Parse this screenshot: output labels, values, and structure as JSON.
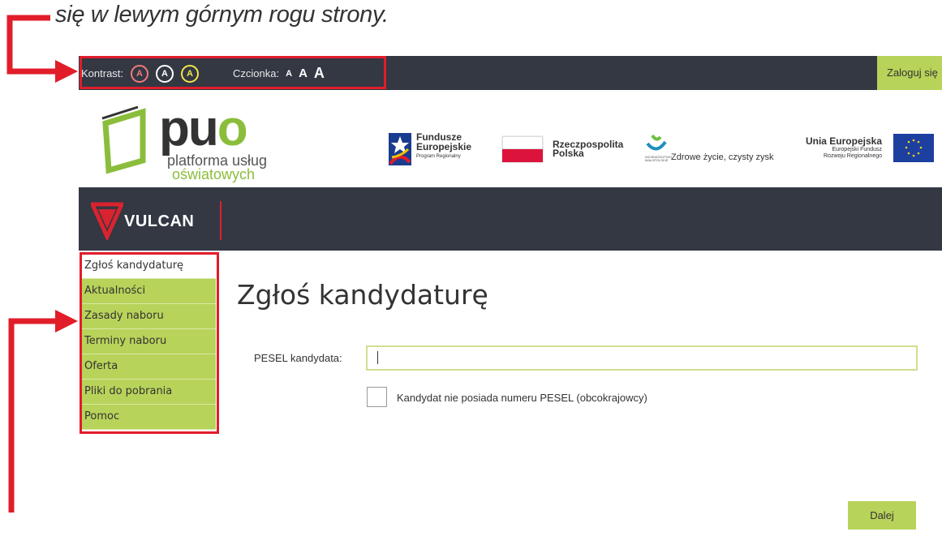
{
  "caption": "się w lewym górnym rogu strony.",
  "topbar": {
    "contrast_label": "Kontrast:",
    "contrast_options": [
      "A",
      "A",
      "A"
    ],
    "font_label": "Czcionka:",
    "font_sizes": [
      "A",
      "A",
      "A"
    ],
    "login_label": "Zaloguj się"
  },
  "logos": {
    "puo_main_a": "pu",
    "puo_main_b": "o",
    "puo_sub1": "platforma usług",
    "puo_sub2": "oświatowych",
    "fe_title1": "Fundusze",
    "fe_title2": "Europejskie",
    "fe_sub": "Program Regionalny",
    "rp_line1": "Rzeczpospolita",
    "rp_line2": "Polska",
    "mr_sub": "WOJEWÓDZTWO MAŁOPOLSKIE",
    "mr_slogan": "Zdrowe życie, czysty zysk",
    "ue_title": "Unia Europejska",
    "ue_sub1": "Europejski Fundusz",
    "ue_sub2": "Rozwoju Regionalnego",
    "vulcan": "VULCAN"
  },
  "sidebar": {
    "items": [
      {
        "label": "Zgłoś kandydaturę",
        "active": true
      },
      {
        "label": "Aktualności"
      },
      {
        "label": "Zasady naboru"
      },
      {
        "label": "Terminy naboru"
      },
      {
        "label": "Oferta"
      },
      {
        "label": "Pliki do pobrania"
      },
      {
        "label": "Pomoc"
      }
    ]
  },
  "main": {
    "title": "Zgłoś kandydaturę",
    "pesel_label": "PESEL kandydata:",
    "pesel_value": "",
    "no_pesel_label": "Kandydat nie posiada numeru PESEL (obcokrajowcy)",
    "next_label": "Dalej"
  },
  "colors": {
    "accent": "#b8d35a",
    "dark": "#333843",
    "highlight": "#e11d2a"
  }
}
